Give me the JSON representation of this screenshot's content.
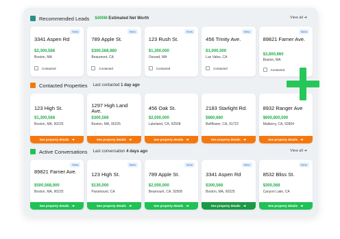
{
  "colors": {
    "green": "#1fae4b",
    "orange": "#f5780f",
    "teal": "#2a8f86",
    "button_green": "#20c255"
  },
  "recommended": {
    "title": "Recommended Leads",
    "stat_value": "$400M",
    "stat_label": "Estimated Net Worth",
    "view_all": "View all",
    "cards": [
      {
        "badge": "New",
        "address": "3341 Aspen Rd",
        "price": "$2,300,568",
        "location": "Boston, MA",
        "checkbox_label": "Contacted"
      },
      {
        "badge": "New",
        "address": "789 Apple St.",
        "price": "$300,568,980",
        "location": "Beaumont, CA",
        "checkbox_label": "Contacted"
      },
      {
        "badge": "New",
        "address": "123 Rush St.",
        "price": "$1,300,000",
        "location": "Oxnard, MA",
        "checkbox_label": "Contacted"
      },
      {
        "badge": "New",
        "address": "456 Trinity Ave.",
        "price": "$1,000,000",
        "location": "Las Vales, CA",
        "checkbox_label": "Contacted"
      },
      {
        "badge": "New",
        "address": "89821 Farner Ave.",
        "price": "$3,800,660",
        "location": "Boston, MA",
        "checkbox_label": "Contacted"
      }
    ]
  },
  "contacted": {
    "title": "Contacted Properties",
    "sub_label": "Last contacted",
    "sub_value": "1 day ago",
    "cards": [
      {
        "address": "123 High St.",
        "price": "$1,300,568",
        "location": "Boston, MA, 90225",
        "button": "See property details"
      },
      {
        "address": "1297 High Land Ave.",
        "price": "$300,568",
        "location": "Boston, MA, 90225",
        "button": "See property details"
      },
      {
        "address": "456 Oak St.",
        "price": "$2,000,000",
        "location": "Lakeland, CA, 92508",
        "button": "See property details"
      },
      {
        "address": "2183 Starlight Rd.",
        "price": "$860,680",
        "location": "Bellflower, CA, 91722",
        "button": "See property details"
      },
      {
        "address": "8932 Ranger Ave",
        "price": "$600,800,000",
        "location": "Mulberry, CA, 92804",
        "button": "See property details"
      }
    ]
  },
  "conversations": {
    "title": "Active Conversations",
    "sub_label": "Last conversation",
    "sub_value": "4 days ago",
    "view_all": "View all",
    "cards": [
      {
        "badge": "New",
        "address": "89821 Farner Ave.",
        "price": "$500,568,000",
        "location": "Boston, MA, 90225",
        "button": "See property details"
      },
      {
        "badge": "New",
        "address": "123 High St.",
        "price": "$130,000",
        "location": "Paramount, CA",
        "button": "See property details"
      },
      {
        "badge": "New",
        "address": "789 Apple St.",
        "price": "$2,000,000",
        "location": "Beamount, CA, 92508",
        "button": "See property details"
      },
      {
        "badge": "New",
        "address": "3341 Aspen Rd",
        "price": "$300,568",
        "location": "Boston, MA, 90225",
        "button": "See property details"
      },
      {
        "badge": "New",
        "address": "8532 Bliss St.",
        "price": "$300,568",
        "location": "Canyon Lake, CA",
        "button": "See property details"
      }
    ]
  },
  "icons": {
    "plus": "plus-icon",
    "arrow": "arrow-right-icon"
  }
}
